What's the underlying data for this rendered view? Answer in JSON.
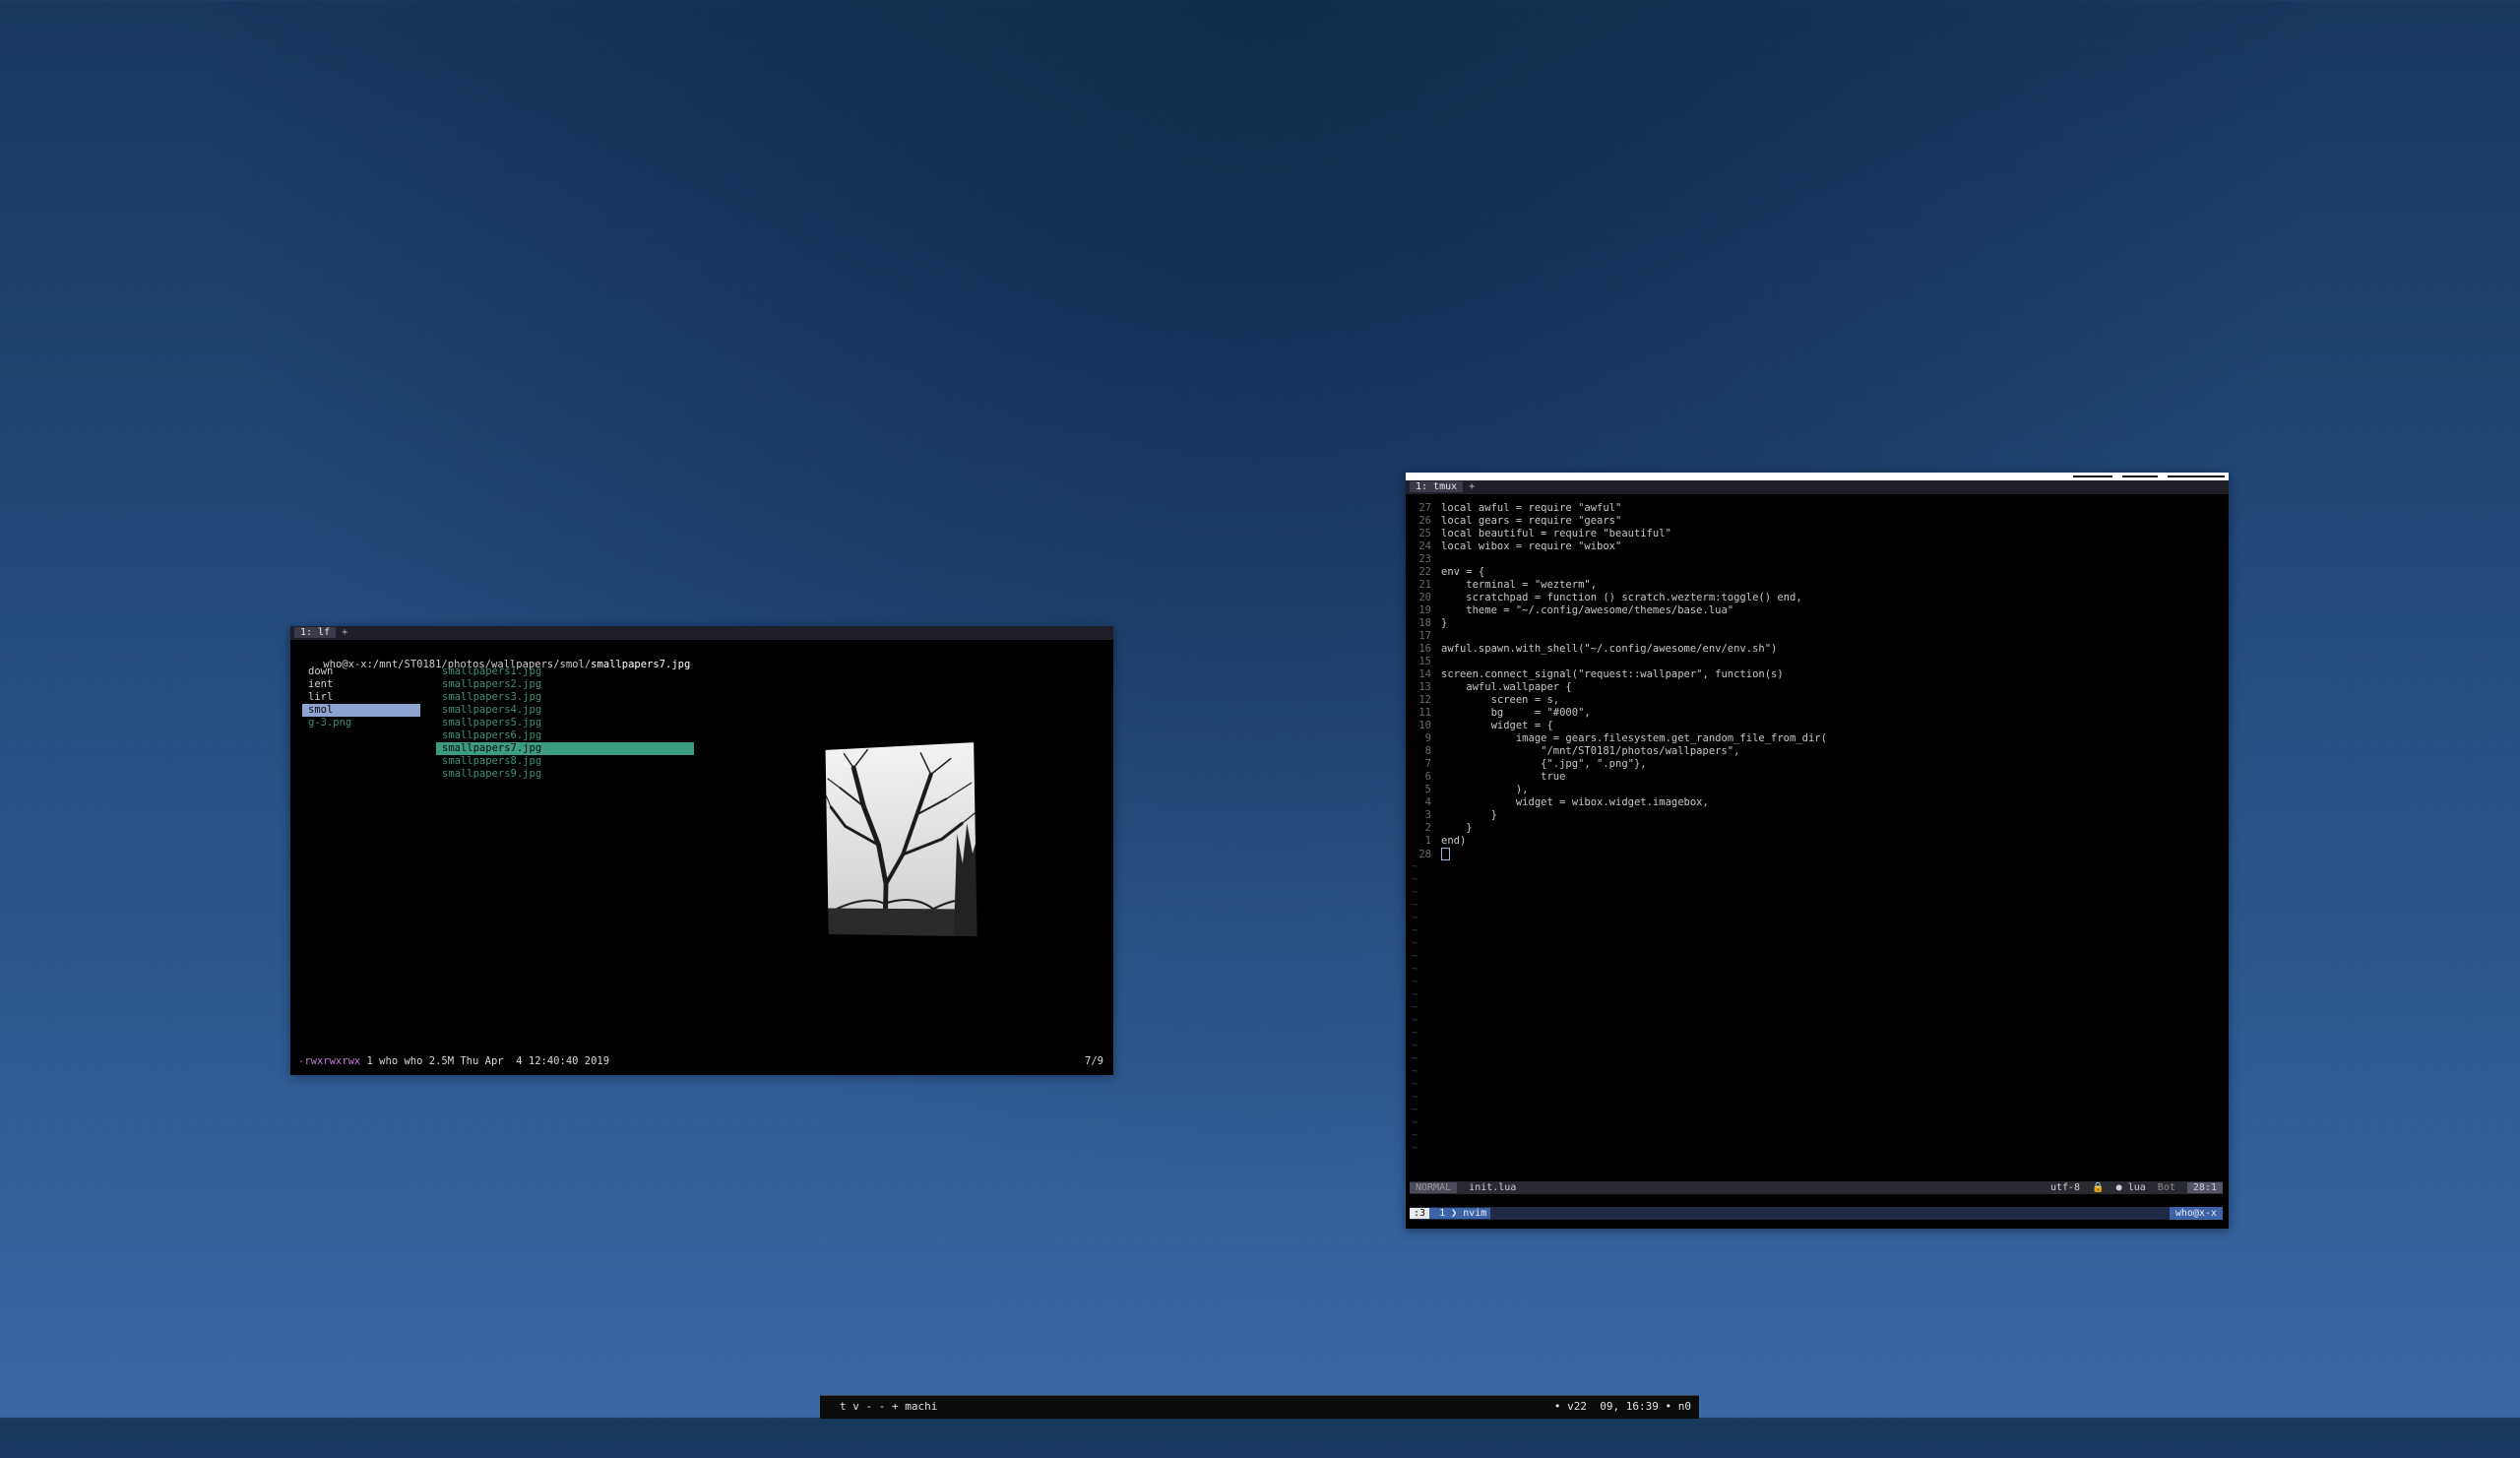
{
  "lf": {
    "tab_label": "1: lf",
    "tab_plus": "+",
    "path_user": "who@x-x",
    "path_dir": ":/mnt/ST0181/photos/wallpapers/smol/",
    "path_file": "smallpapers7.jpg",
    "parent_entries": [
      "down",
      "ient",
      "lirl",
      "smol",
      "g-3.png"
    ],
    "files": [
      "smallpapers1.jpg",
      "smallpapers2.jpg",
      "smallpapers3.jpg",
      "smallpapers4.jpg",
      "smallpapers5.jpg",
      "smallpapers6.jpg",
      "smallpapers7.jpg",
      "smallpapers8.jpg",
      "smallpapers9.jpg"
    ],
    "status_perm": "-rwxrwxrwx",
    "status_rest": " 1 who who 2.5M Thu Apr  4 12:40:40 2019",
    "count": "7/9"
  },
  "nvim": {
    "tab_label": "1: tmux",
    "tab_plus": "+",
    "code_lines": [
      {
        "n": "27",
        "t": "local awful = require \"awful\""
      },
      {
        "n": "26",
        "t": "local gears = require \"gears\""
      },
      {
        "n": "25",
        "t": "local beautiful = require \"beautiful\""
      },
      {
        "n": "24",
        "t": "local wibox = require \"wibox\""
      },
      {
        "n": "23",
        "t": ""
      },
      {
        "n": "22",
        "t": "env = {"
      },
      {
        "n": "21",
        "t": "    terminal = \"wezterm\","
      },
      {
        "n": "20",
        "t": "    scratchpad = function () scratch.wezterm:toggle() end,"
      },
      {
        "n": "19",
        "t": "    theme = \"~/.config/awesome/themes/base.lua\""
      },
      {
        "n": "18",
        "t": "}"
      },
      {
        "n": "17",
        "t": ""
      },
      {
        "n": "16",
        "t": "awful.spawn.with_shell(\"~/.config/awesome/env/env.sh\")"
      },
      {
        "n": "15",
        "t": ""
      },
      {
        "n": "14",
        "t": "screen.connect_signal(\"request::wallpaper\", function(s)"
      },
      {
        "n": "13",
        "t": "    awful.wallpaper {"
      },
      {
        "n": "12",
        "t": "        screen = s,"
      },
      {
        "n": "11",
        "t": "        bg     = \"#000\","
      },
      {
        "n": "10",
        "t": "        widget = {"
      },
      {
        "n": "9",
        "t": "            image = gears.filesystem.get_random_file_from_dir("
      },
      {
        "n": "8",
        "t": "                \"/mnt/ST0181/photos/wallpapers\","
      },
      {
        "n": "7",
        "t": "                {\".jpg\", \".png\"},"
      },
      {
        "n": "6",
        "t": "                true"
      },
      {
        "n": "5",
        "t": "            ),"
      },
      {
        "n": "4",
        "t": "            widget = wibox.widget.imagebox,"
      },
      {
        "n": "3",
        "t": "        }"
      },
      {
        "n": "2",
        "t": "    }"
      },
      {
        "n": "1",
        "t": "end)"
      },
      {
        "n": "28",
        "t": ""
      }
    ],
    "tilde": "~",
    "mode": "NORMAL",
    "filename": "init.lua",
    "encoding": "utf-8",
    "filetype": "lua",
    "scroll": "Bot",
    "position": "28:1",
    "tmux_session": ":3",
    "tmux_window_num": "1",
    "tmux_window_name": "nvim",
    "tmux_host": "who@x-x"
  },
  "wibar": {
    "left": "t v - - + machi",
    "right": "• v22  09, 16:39 • n0"
  }
}
